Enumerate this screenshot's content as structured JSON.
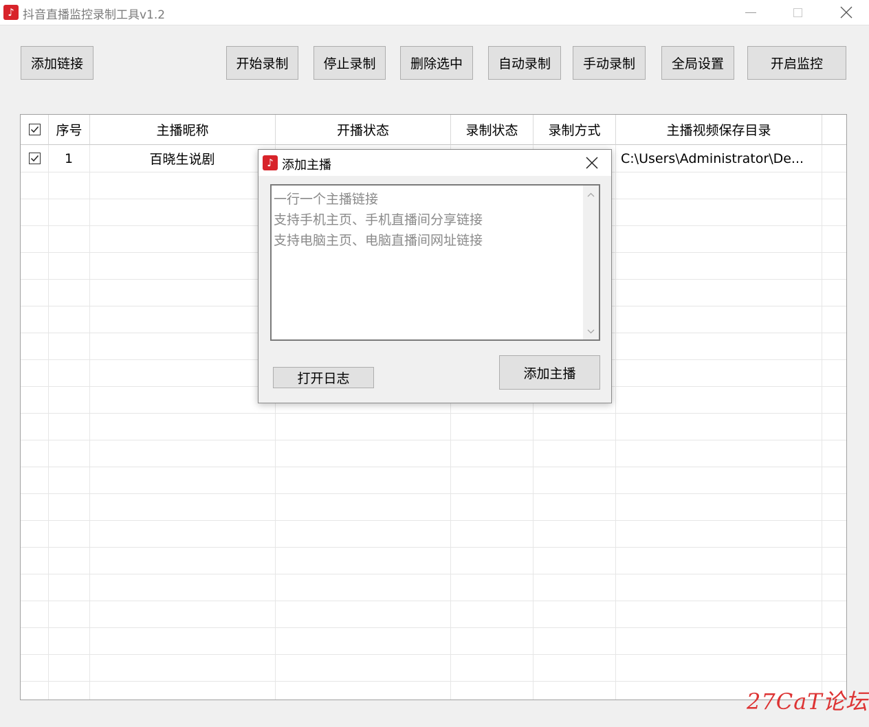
{
  "window": {
    "title": "抖音直播监控录制工具v1.2",
    "icon": "douyin-icon",
    "icon_glyph": "♪",
    "brand_color": "#d8232a"
  },
  "toolbar": {
    "add_link": "添加链接",
    "start_record": "开始录制",
    "stop_record": "停止录制",
    "delete_selected": "删除选中",
    "auto_record": "自动录制",
    "manual_record": "手动录制",
    "global_settings": "全局设置",
    "start_monitor": "开启监控"
  },
  "table": {
    "columns": [
      "序号",
      "主播昵称",
      "开播状态",
      "录制状态",
      "录制方式",
      "主播视频保存目录"
    ],
    "rows": [
      {
        "checked": true,
        "index": "1",
        "nickname": "百晓生说剧",
        "live_status": "",
        "record_status": "",
        "record_mode": "",
        "save_dir": "C:\\Users\\Administrator\\De..."
      }
    ]
  },
  "dialog": {
    "title": "添加主播",
    "placeholder_lines": [
      "一行一个主播链接",
      "支持手机主页、手机直播间分享链接",
      "支持电脑主页、电脑直播间网址链接"
    ],
    "open_log": "打开日志",
    "add_anchor": "添加主播"
  },
  "watermark": "27CaT论坛"
}
